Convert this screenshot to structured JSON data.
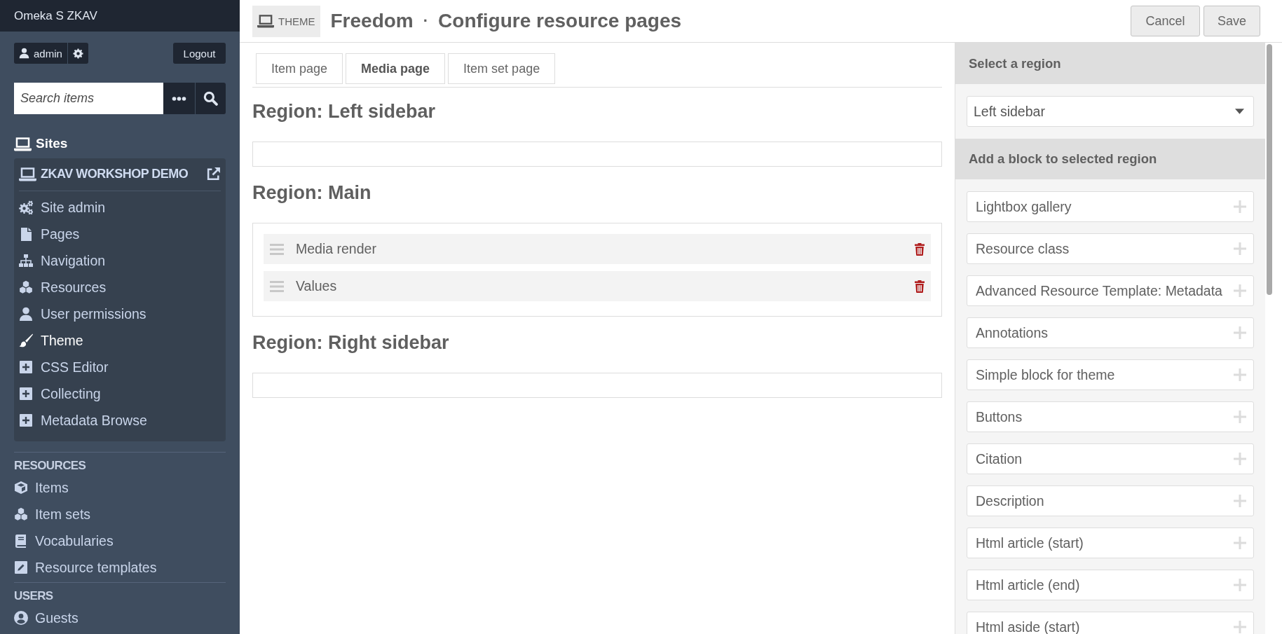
{
  "sidebar": {
    "brand": "Omeka S ZKAV",
    "user": "admin",
    "logout": "Logout",
    "search": {
      "placeholder": "Search items"
    },
    "sites_title": "Sites",
    "site": {
      "name": "ZKAV WORKSHOP DEMO",
      "items": [
        {
          "label": "Site admin",
          "selected": false
        },
        {
          "label": "Pages",
          "selected": false
        },
        {
          "label": "Navigation",
          "selected": false
        },
        {
          "label": "Resources",
          "selected": false
        },
        {
          "label": "User permissions",
          "selected": false
        },
        {
          "label": "Theme",
          "selected": true
        },
        {
          "label": "CSS Editor",
          "selected": false
        },
        {
          "label": "Collecting",
          "selected": false
        },
        {
          "label": "Metadata Browse",
          "selected": false
        }
      ]
    },
    "sections": [
      {
        "title": "RESOURCES",
        "items": [
          {
            "label": "Items",
            "selected": false
          },
          {
            "label": "Item sets",
            "selected": false
          },
          {
            "label": "Vocabularies",
            "selected": false
          },
          {
            "label": "Resource templates",
            "selected": false
          }
        ]
      },
      {
        "title": "USERS",
        "items": [
          {
            "label": "Guests",
            "selected": false
          }
        ]
      }
    ]
  },
  "header": {
    "badge": "THEME",
    "title": "Freedom",
    "separator": "·",
    "subtitle": "Configure resource pages",
    "buttons": [
      "Cancel",
      "Save"
    ]
  },
  "tabs": [
    {
      "label": "Item page",
      "selected": false
    },
    {
      "label": "Media page",
      "selected": true
    },
    {
      "label": "Item set page",
      "selected": false
    }
  ],
  "regions": [
    {
      "title": "Region: Left sidebar"
    },
    {
      "title": "Region: Main",
      "blocks": [
        "Media render",
        "Values"
      ]
    },
    {
      "title": "Region: Right sidebar"
    }
  ],
  "panel": {
    "select_heading": "Select a region",
    "select_value": "Left sidebar",
    "add_heading": "Add a block to selected region",
    "blocks": [
      "Lightbox gallery",
      "Resource class",
      "Advanced Resource Template: Metadata",
      "Annotations",
      "Simple block for theme",
      "Buttons",
      "Citation",
      "Description",
      "Html article (start)",
      "Html article (end)",
      "Html aside (start)"
    ]
  }
}
